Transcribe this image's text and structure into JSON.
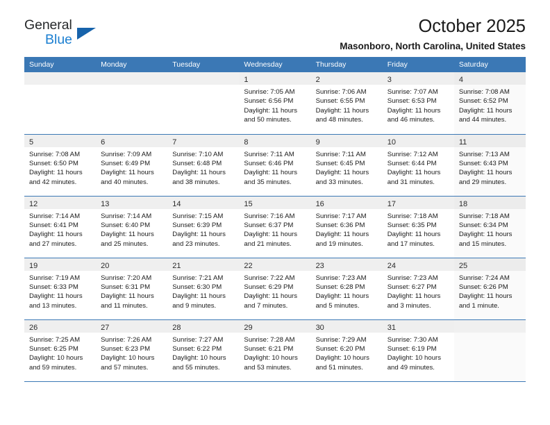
{
  "brand": {
    "name_part1": "General",
    "name_part2": "Blue",
    "triangle_icon": "brand-triangle-icon",
    "colors": {
      "dark": "#26292b",
      "blue": "#1b7fd1",
      "triangle": "#1763ab"
    }
  },
  "header": {
    "title": "October 2025",
    "subtitle": "Masonboro, North Carolina, United States"
  },
  "theme": {
    "header_blue": "#3b78b5",
    "daynum_band": "#efefef",
    "row_border": "#3b78b5",
    "saturday_tint": "#fafafa"
  },
  "calendar": {
    "weekday_headers": [
      "Sunday",
      "Monday",
      "Tuesday",
      "Wednesday",
      "Thursday",
      "Friday",
      "Saturday"
    ],
    "labels": {
      "sunrise": "Sunrise:",
      "sunset": "Sunset:",
      "daylight": "Daylight:"
    },
    "weeks": [
      [
        {
          "empty": true
        },
        {
          "empty": true
        },
        {
          "empty": true
        },
        {
          "day": "1",
          "sunrise": "Sunrise: 7:05 AM",
          "sunset": "Sunset: 6:56 PM",
          "daylight": "Daylight: 11 hours and 50 minutes."
        },
        {
          "day": "2",
          "sunrise": "Sunrise: 7:06 AM",
          "sunset": "Sunset: 6:55 PM",
          "daylight": "Daylight: 11 hours and 48 minutes."
        },
        {
          "day": "3",
          "sunrise": "Sunrise: 7:07 AM",
          "sunset": "Sunset: 6:53 PM",
          "daylight": "Daylight: 11 hours and 46 minutes."
        },
        {
          "day": "4",
          "sunrise": "Sunrise: 7:08 AM",
          "sunset": "Sunset: 6:52 PM",
          "daylight": "Daylight: 11 hours and 44 minutes."
        }
      ],
      [
        {
          "day": "5",
          "sunrise": "Sunrise: 7:08 AM",
          "sunset": "Sunset: 6:50 PM",
          "daylight": "Daylight: 11 hours and 42 minutes."
        },
        {
          "day": "6",
          "sunrise": "Sunrise: 7:09 AM",
          "sunset": "Sunset: 6:49 PM",
          "daylight": "Daylight: 11 hours and 40 minutes."
        },
        {
          "day": "7",
          "sunrise": "Sunrise: 7:10 AM",
          "sunset": "Sunset: 6:48 PM",
          "daylight": "Daylight: 11 hours and 38 minutes."
        },
        {
          "day": "8",
          "sunrise": "Sunrise: 7:11 AM",
          "sunset": "Sunset: 6:46 PM",
          "daylight": "Daylight: 11 hours and 35 minutes."
        },
        {
          "day": "9",
          "sunrise": "Sunrise: 7:11 AM",
          "sunset": "Sunset: 6:45 PM",
          "daylight": "Daylight: 11 hours and 33 minutes."
        },
        {
          "day": "10",
          "sunrise": "Sunrise: 7:12 AM",
          "sunset": "Sunset: 6:44 PM",
          "daylight": "Daylight: 11 hours and 31 minutes."
        },
        {
          "day": "11",
          "sunrise": "Sunrise: 7:13 AM",
          "sunset": "Sunset: 6:43 PM",
          "daylight": "Daylight: 11 hours and 29 minutes."
        }
      ],
      [
        {
          "day": "12",
          "sunrise": "Sunrise: 7:14 AM",
          "sunset": "Sunset: 6:41 PM",
          "daylight": "Daylight: 11 hours and 27 minutes."
        },
        {
          "day": "13",
          "sunrise": "Sunrise: 7:14 AM",
          "sunset": "Sunset: 6:40 PM",
          "daylight": "Daylight: 11 hours and 25 minutes."
        },
        {
          "day": "14",
          "sunrise": "Sunrise: 7:15 AM",
          "sunset": "Sunset: 6:39 PM",
          "daylight": "Daylight: 11 hours and 23 minutes."
        },
        {
          "day": "15",
          "sunrise": "Sunrise: 7:16 AM",
          "sunset": "Sunset: 6:37 PM",
          "daylight": "Daylight: 11 hours and 21 minutes."
        },
        {
          "day": "16",
          "sunrise": "Sunrise: 7:17 AM",
          "sunset": "Sunset: 6:36 PM",
          "daylight": "Daylight: 11 hours and 19 minutes."
        },
        {
          "day": "17",
          "sunrise": "Sunrise: 7:18 AM",
          "sunset": "Sunset: 6:35 PM",
          "daylight": "Daylight: 11 hours and 17 minutes."
        },
        {
          "day": "18",
          "sunrise": "Sunrise: 7:18 AM",
          "sunset": "Sunset: 6:34 PM",
          "daylight": "Daylight: 11 hours and 15 minutes."
        }
      ],
      [
        {
          "day": "19",
          "sunrise": "Sunrise: 7:19 AM",
          "sunset": "Sunset: 6:33 PM",
          "daylight": "Daylight: 11 hours and 13 minutes."
        },
        {
          "day": "20",
          "sunrise": "Sunrise: 7:20 AM",
          "sunset": "Sunset: 6:31 PM",
          "daylight": "Daylight: 11 hours and 11 minutes."
        },
        {
          "day": "21",
          "sunrise": "Sunrise: 7:21 AM",
          "sunset": "Sunset: 6:30 PM",
          "daylight": "Daylight: 11 hours and 9 minutes."
        },
        {
          "day": "22",
          "sunrise": "Sunrise: 7:22 AM",
          "sunset": "Sunset: 6:29 PM",
          "daylight": "Daylight: 11 hours and 7 minutes."
        },
        {
          "day": "23",
          "sunrise": "Sunrise: 7:23 AM",
          "sunset": "Sunset: 6:28 PM",
          "daylight": "Daylight: 11 hours and 5 minutes."
        },
        {
          "day": "24",
          "sunrise": "Sunrise: 7:23 AM",
          "sunset": "Sunset: 6:27 PM",
          "daylight": "Daylight: 11 hours and 3 minutes."
        },
        {
          "day": "25",
          "sunrise": "Sunrise: 7:24 AM",
          "sunset": "Sunset: 6:26 PM",
          "daylight": "Daylight: 11 hours and 1 minute."
        }
      ],
      [
        {
          "day": "26",
          "sunrise": "Sunrise: 7:25 AM",
          "sunset": "Sunset: 6:25 PM",
          "daylight": "Daylight: 10 hours and 59 minutes."
        },
        {
          "day": "27",
          "sunrise": "Sunrise: 7:26 AM",
          "sunset": "Sunset: 6:23 PM",
          "daylight": "Daylight: 10 hours and 57 minutes."
        },
        {
          "day": "28",
          "sunrise": "Sunrise: 7:27 AM",
          "sunset": "Sunset: 6:22 PM",
          "daylight": "Daylight: 10 hours and 55 minutes."
        },
        {
          "day": "29",
          "sunrise": "Sunrise: 7:28 AM",
          "sunset": "Sunset: 6:21 PM",
          "daylight": "Daylight: 10 hours and 53 minutes."
        },
        {
          "day": "30",
          "sunrise": "Sunrise: 7:29 AM",
          "sunset": "Sunset: 6:20 PM",
          "daylight": "Daylight: 10 hours and 51 minutes."
        },
        {
          "day": "31",
          "sunrise": "Sunrise: 7:30 AM",
          "sunset": "Sunset: 6:19 PM",
          "daylight": "Daylight: 10 hours and 49 minutes."
        },
        {
          "empty": true
        }
      ]
    ]
  }
}
